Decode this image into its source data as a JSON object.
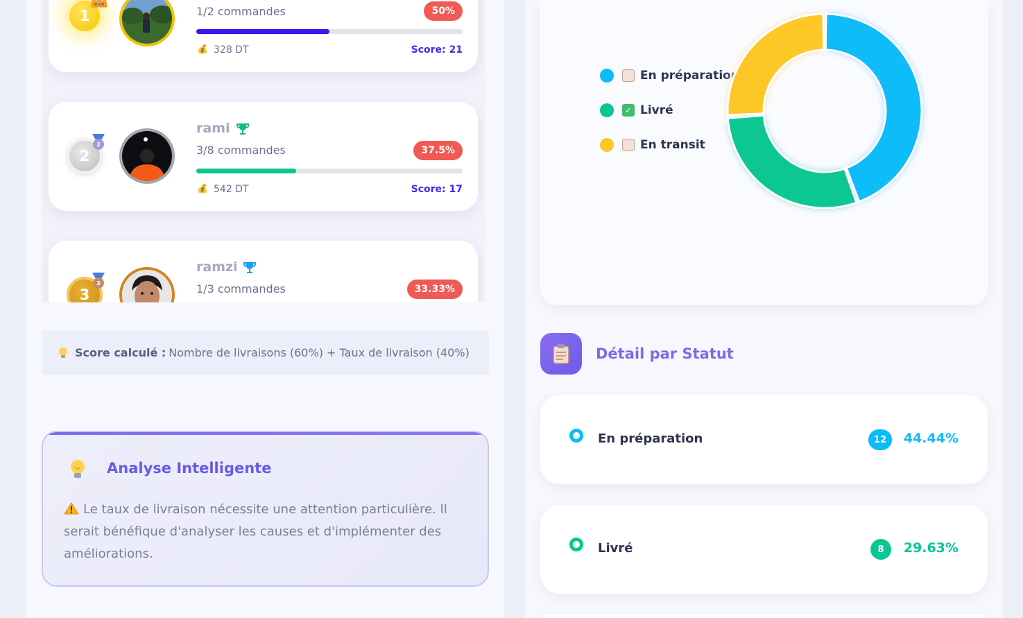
{
  "leaderboard": {
    "entries": [
      {
        "rank": "1",
        "name": "",
        "orders": "1/2 commandes",
        "percent_label": "50%",
        "percent": 0.5,
        "amount": "328 DT",
        "score": "Score: 21",
        "bar_color": "#3d16f0"
      },
      {
        "rank": "2",
        "name": "rami",
        "orders": "3/8 commandes",
        "percent_label": "37.5%",
        "percent": 0.375,
        "amount": "542 DT",
        "score": "Score: 17",
        "bar_color": "#08c793"
      },
      {
        "rank": "3",
        "name": "ramzi",
        "orders": "1/3 commandes",
        "percent_label": "33.33%",
        "percent": 0.3333,
        "amount": "",
        "score": ""
      }
    ],
    "medal_numbers": [
      "2",
      "3"
    ]
  },
  "score_note": {
    "label": "Score calculé :",
    "text": "Nombre de livraisons (60%) + Taux de livraison (40%)"
  },
  "analysis": {
    "title": "Analyse Intelligente",
    "text": "Le taux de livraison nécessite une attention particulière. Il serait bénéfique d'analyser les causes et d'implémenter des améliorations."
  },
  "chart_data": {
    "type": "pie",
    "categories": [
      "En préparation",
      "Livré",
      "En transit"
    ],
    "values": [
      12,
      8,
      7
    ],
    "colors": [
      "#0bbcf8",
      "#08c793",
      "#fdc727"
    ],
    "legend_position": "left"
  },
  "legend": [
    {
      "label": "En préparation",
      "color": "#0bbcf8",
      "icon": "clipboard-icon"
    },
    {
      "label": "Livré",
      "color": "#08c793",
      "icon": "check-box-icon"
    },
    {
      "label": "En transit",
      "color": "#fdc727",
      "icon": "clipboard-icon"
    }
  ],
  "detail": {
    "title": "Détail par Statut",
    "items": [
      {
        "label": "En préparation",
        "count": "12",
        "percent": "44.44%",
        "color": "#0bbcf8"
      },
      {
        "label": "Livré",
        "count": "8",
        "percent": "29.63%",
        "color": "#08c793"
      }
    ]
  }
}
